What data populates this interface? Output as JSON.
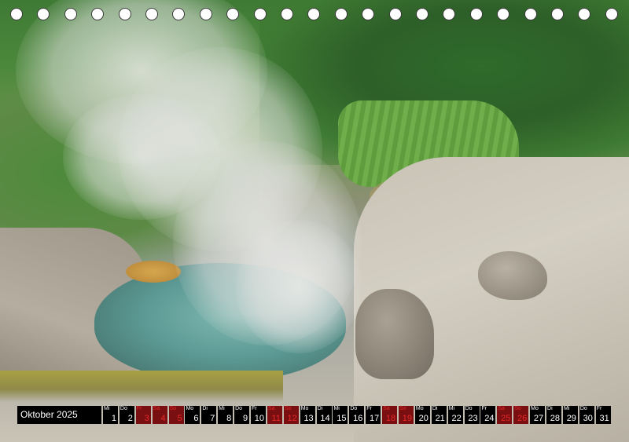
{
  "calendar": {
    "month_label": "Oktober 2025",
    "days": [
      {
        "wd": "Mi",
        "d": "1",
        "weekend": false
      },
      {
        "wd": "Do",
        "d": "2",
        "weekend": false
      },
      {
        "wd": "Fr",
        "d": "3",
        "weekend": true
      },
      {
        "wd": "Sa",
        "d": "4",
        "weekend": true
      },
      {
        "wd": "So",
        "d": "5",
        "weekend": true
      },
      {
        "wd": "Mo",
        "d": "6",
        "weekend": false
      },
      {
        "wd": "Di",
        "d": "7",
        "weekend": false
      },
      {
        "wd": "Mi",
        "d": "8",
        "weekend": false
      },
      {
        "wd": "Do",
        "d": "9",
        "weekend": false
      },
      {
        "wd": "Fr",
        "d": "10",
        "weekend": false
      },
      {
        "wd": "Sa",
        "d": "11",
        "weekend": true
      },
      {
        "wd": "So",
        "d": "12",
        "weekend": true
      },
      {
        "wd": "Mo",
        "d": "13",
        "weekend": false
      },
      {
        "wd": "Di",
        "d": "14",
        "weekend": false
      },
      {
        "wd": "Mi",
        "d": "15",
        "weekend": false
      },
      {
        "wd": "Do",
        "d": "16",
        "weekend": false
      },
      {
        "wd": "Fr",
        "d": "17",
        "weekend": false
      },
      {
        "wd": "Sa",
        "d": "18",
        "weekend": true
      },
      {
        "wd": "So",
        "d": "19",
        "weekend": true
      },
      {
        "wd": "Mo",
        "d": "20",
        "weekend": false
      },
      {
        "wd": "Di",
        "d": "21",
        "weekend": false
      },
      {
        "wd": "Mi",
        "d": "22",
        "weekend": false
      },
      {
        "wd": "Do",
        "d": "23",
        "weekend": false
      },
      {
        "wd": "Fr",
        "d": "24",
        "weekend": false
      },
      {
        "wd": "Sa",
        "d": "25",
        "weekend": true
      },
      {
        "wd": "So",
        "d": "26",
        "weekend": true
      },
      {
        "wd": "Mo",
        "d": "27",
        "weekend": false
      },
      {
        "wd": "Di",
        "d": "28",
        "weekend": false
      },
      {
        "wd": "Mi",
        "d": "29",
        "weekend": false
      },
      {
        "wd": "Do",
        "d": "30",
        "weekend": false
      },
      {
        "wd": "Fr",
        "d": "31",
        "weekend": false
      }
    ],
    "weekend_bg": "#7a0f12",
    "weekend_text": "#e52a2a",
    "weekday_bg": "#000000"
  }
}
